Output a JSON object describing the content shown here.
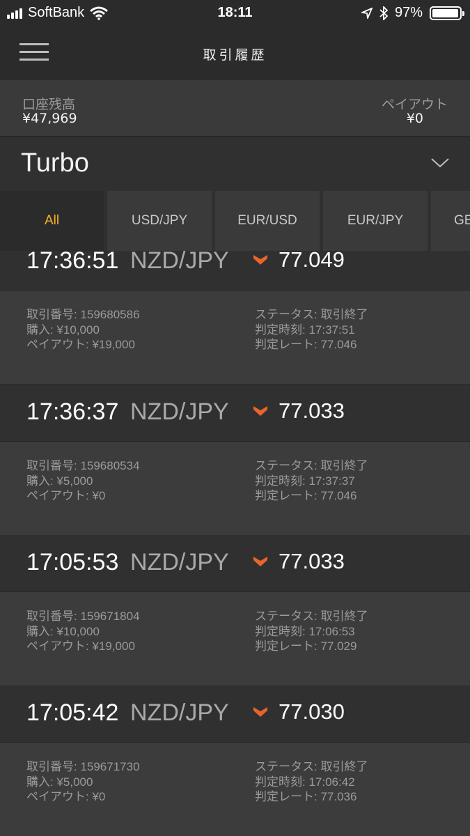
{
  "status_bar": {
    "carrier": "SoftBank",
    "time": "18:11",
    "battery": "97%",
    "battery_level": 0.97
  },
  "header": {
    "title": "取引履歴",
    "menu_icon": "hamburger-menu-icon"
  },
  "account": {
    "balance_label": "口座残高",
    "balance_value": "¥47,969",
    "payout_label": "ペイアウト",
    "payout_value": "¥0"
  },
  "product": {
    "name": "Turbo",
    "icon": "chevron-down-icon"
  },
  "tabs": [
    {
      "label": "All",
      "active": true
    },
    {
      "label": "USD/JPY",
      "active": false
    },
    {
      "label": "EUR/USD",
      "active": false
    },
    {
      "label": "EUR/JPY",
      "active": false
    },
    {
      "label": "GE",
      "active": false
    }
  ],
  "colors": {
    "accent": "#f5b324",
    "down_arrow": "#e8652a",
    "background": "#2b2b2b"
  },
  "trades": [
    {
      "time": "17:36:51",
      "pair": "NZD/JPY",
      "direction": "down",
      "rate": "77.049",
      "trade_no": "取引番号: 159680586",
      "purchase": "購入: ¥10,000",
      "payout": "ペイアウト: ¥19,000",
      "status": "ステータス: 取引終了",
      "judge_time": "判定時刻: 17:37:51",
      "judge_rate": "判定レート: 77.046"
    },
    {
      "time": "17:36:37",
      "pair": "NZD/JPY",
      "direction": "down",
      "rate": "77.033",
      "trade_no": "取引番号: 159680534",
      "purchase": "購入: ¥5,000",
      "payout": "ペイアウト: ¥0",
      "status": "ステータス: 取引終了",
      "judge_time": "判定時刻: 17:37:37",
      "judge_rate": "判定レート: 77.046"
    },
    {
      "time": "17:05:53",
      "pair": "NZD/JPY",
      "direction": "down",
      "rate": "77.033",
      "trade_no": "取引番号: 159671804",
      "purchase": "購入: ¥10,000",
      "payout": "ペイアウト: ¥19,000",
      "status": "ステータス: 取引終了",
      "judge_time": "判定時刻: 17:06:53",
      "judge_rate": "判定レート: 77.029"
    },
    {
      "time": "17:05:42",
      "pair": "NZD/JPY",
      "direction": "down",
      "rate": "77.030",
      "trade_no": "取引番号: 159671730",
      "purchase": "購入: ¥5,000",
      "payout": "ペイアウト: ¥0",
      "status": "ステータス: 取引終了",
      "judge_time": "判定時刻: 17:06:42",
      "judge_rate": "判定レート: 77.036"
    }
  ]
}
